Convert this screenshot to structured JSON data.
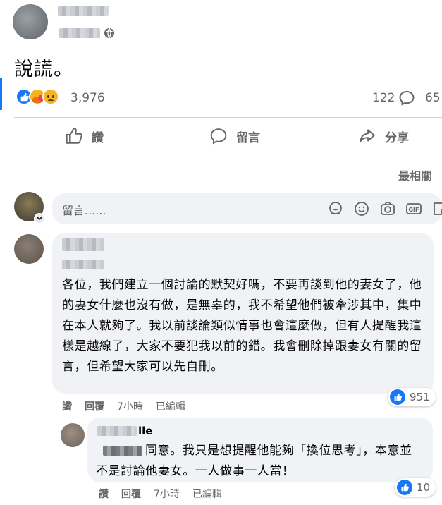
{
  "post": {
    "text": "說謊。",
    "reaction_count": "3,976",
    "comment_count": "122",
    "share_count": "65",
    "sort_label": "最相關"
  },
  "actions": {
    "like": "讚",
    "comment": "留言",
    "share": "分享"
  },
  "composer": {
    "placeholder": "留言......"
  },
  "comments": [
    {
      "text": "各位，我們建立一個討論的默契好嗎，不要再談到他的妻女了，他的妻女什麼也沒有做，是無辜的，我不希望他們被牽涉其中，集中在本人就夠了。我以前談論類似情事也會這麼做，但有人提醒我這樣是越線了，大家不要犯我以前的錯。我會刪除掉跟妻女有關的留言，但希望大家可以先自刪。",
      "like": "讚",
      "reply": "回覆",
      "time": "7小時",
      "edited": "已編輯",
      "likes": "951"
    },
    {
      "name_partial": "lle",
      "text": "同意。我只是想提醒他能夠「換位思考」，本意並不是討論他妻女。一人做事一人當！",
      "like": "讚",
      "reply": "回覆",
      "time": "7小時",
      "edited": "已編輯",
      "likes": "10"
    }
  ],
  "colors": {
    "accent": "#1877f2",
    "secondary_text": "#65676b",
    "bubble_bg": "#f0f2f5"
  }
}
